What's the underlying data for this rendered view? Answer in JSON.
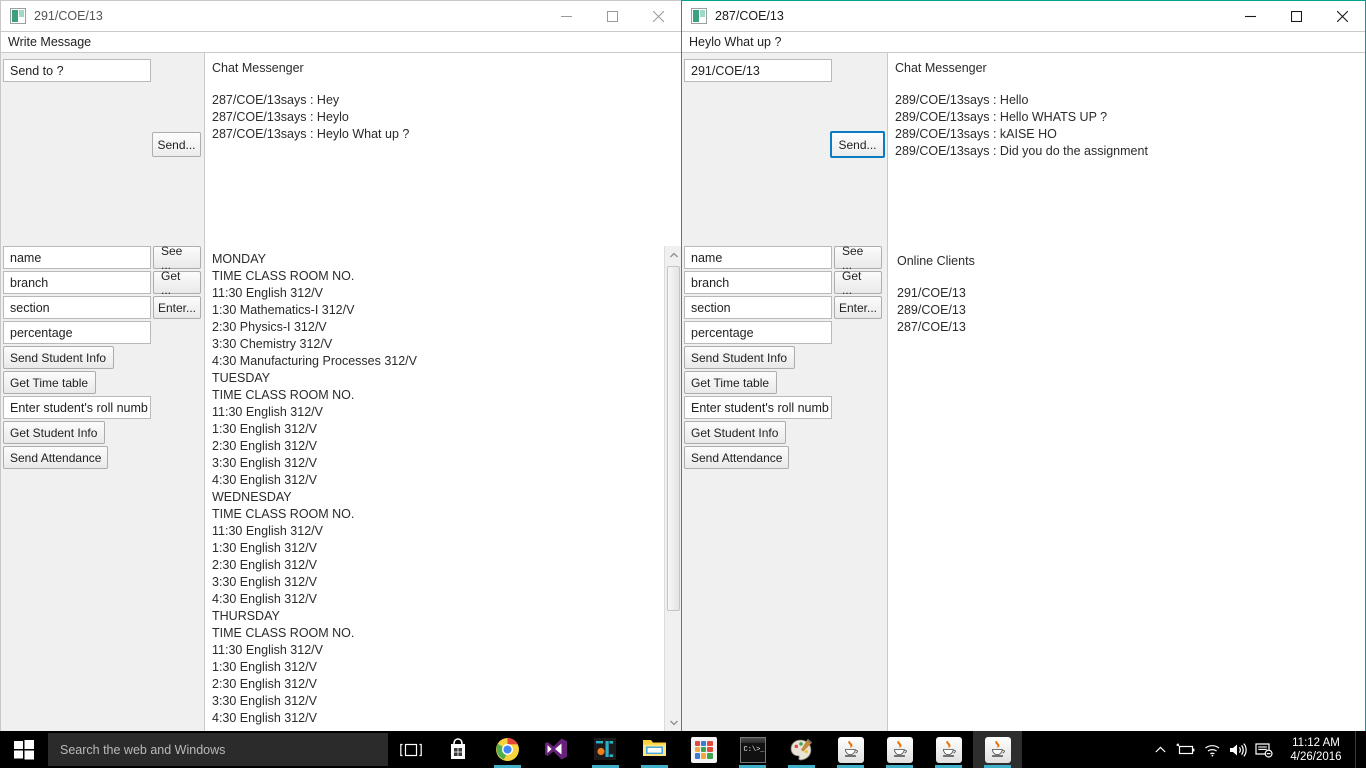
{
  "windows": {
    "left": {
      "title": "291/COE/13",
      "icon": "java-app-icon",
      "message_field": "Write Message",
      "send_to_value": "Send to ?",
      "send_button": "Send...",
      "chat": {
        "title": "Chat Messenger",
        "lines": [
          "287/COE/13says : Hey",
          "287/COE/13says : Heylo",
          "287/COE/13says : Heylo What up ?"
        ]
      },
      "fields": [
        {
          "value": "name"
        },
        {
          "value": "branch"
        },
        {
          "value": "section"
        },
        {
          "value": "percentage"
        }
      ],
      "side_buttons": [
        {
          "label": "See ..."
        },
        {
          "label": "Get ..."
        },
        {
          "label": "Enter..."
        }
      ],
      "wide_buttons": [
        {
          "label": "Send Student Info",
          "type": "button"
        },
        {
          "label": "Get Time table",
          "type": "button"
        },
        {
          "label": "Enter student's roll numb",
          "type": "textfield"
        },
        {
          "label": "Get Student Info",
          "type": "button"
        },
        {
          "label": "Send Attendance",
          "type": "button"
        }
      ],
      "timetable": [
        "MONDAY",
        "TIME  CLASS  ROOM NO.",
        "11:30  English  312/V",
        "1:30  Mathematics-I  312/V",
        "2:30  Physics-I  312/V",
        "3:30  Chemistry  312/V",
        "4:30  Manufacturing Processes  312/V",
        "TUESDAY",
        "TIME  CLASS  ROOM NO.",
        "11:30  English  312/V",
        "1:30  English  312/V",
        "2:30  English  312/V",
        "3:30  English  312/V",
        "4:30  English  312/V",
        "WEDNESDAY",
        "TIME  CLASS  ROOM NO.",
        "11:30  English  312/V",
        "1:30  English  312/V",
        "2:30  English  312/V",
        "3:30  English  312/V",
        "4:30  English  312/V",
        "THURSDAY",
        "TIME  CLASS  ROOM NO.",
        "11:30  English  312/V",
        "1:30  English  312/V",
        "2:30  English  312/V",
        "3:30  English  312/V",
        "4:30  English  312/V"
      ]
    },
    "right": {
      "title": "287/COE/13",
      "icon": "java-app-icon",
      "message_field": "Heylo What up ?",
      "send_to_value": "291/COE/13",
      "send_button": "Send...",
      "chat": {
        "title": "Chat Messenger",
        "lines": [
          "289/COE/13says : Hello",
          "289/COE/13says : Hello WHATS UP ?",
          "289/COE/13says : kAISE HO",
          "289/COE/13says : Did you do the assignment"
        ]
      },
      "fields": [
        {
          "value": "name"
        },
        {
          "value": "branch"
        },
        {
          "value": "section"
        },
        {
          "value": "percentage"
        }
      ],
      "side_buttons": [
        {
          "label": "See ..."
        },
        {
          "label": "Get ..."
        },
        {
          "label": "Enter..."
        }
      ],
      "wide_buttons": [
        {
          "label": "Send Student Info",
          "type": "button"
        },
        {
          "label": "Get Time table",
          "type": "button"
        },
        {
          "label": "Enter student's roll numb",
          "type": "textfield"
        },
        {
          "label": "Get Student Info",
          "type": "button"
        },
        {
          "label": "Send Attendance",
          "type": "button"
        }
      ],
      "online": {
        "title": "Online Clients",
        "clients": [
          "291/COE/13",
          "289/COE/13",
          "287/COE/13"
        ]
      }
    }
  },
  "window_controls": {
    "minimize": "minimize-icon",
    "maximize": "maximize-icon",
    "close": "close-icon"
  },
  "taskbar": {
    "start": "windows-start-icon",
    "search_placeholder": "Search the web and Windows",
    "task_view": "task-view-icon",
    "apps": [
      {
        "name": "store-icon"
      },
      {
        "name": "chrome-icon"
      },
      {
        "name": "visual-studio-icon"
      },
      {
        "name": "intellij-idea-icon"
      },
      {
        "name": "file-explorer-icon"
      },
      {
        "name": "app-grid-icon"
      },
      {
        "name": "command-prompt-icon"
      },
      {
        "name": "paint-icon"
      },
      {
        "name": "java-app-icon"
      },
      {
        "name": "java-app-icon"
      },
      {
        "name": "java-app-icon"
      },
      {
        "name": "java-app-icon"
      }
    ],
    "tray": [
      {
        "name": "chevron-up-icon"
      },
      {
        "name": "battery-icon"
      },
      {
        "name": "wifi-icon"
      },
      {
        "name": "volume-icon"
      },
      {
        "name": "action-center-icon"
      }
    ],
    "clock": {
      "time": "11:12 AM",
      "date": "4/26/2016"
    }
  },
  "colors": {
    "active_window_border": "#00a38a",
    "focus_ring": "#0d7bc4",
    "taskbar": "#000000",
    "running_indicator": "#3fb0c8"
  }
}
